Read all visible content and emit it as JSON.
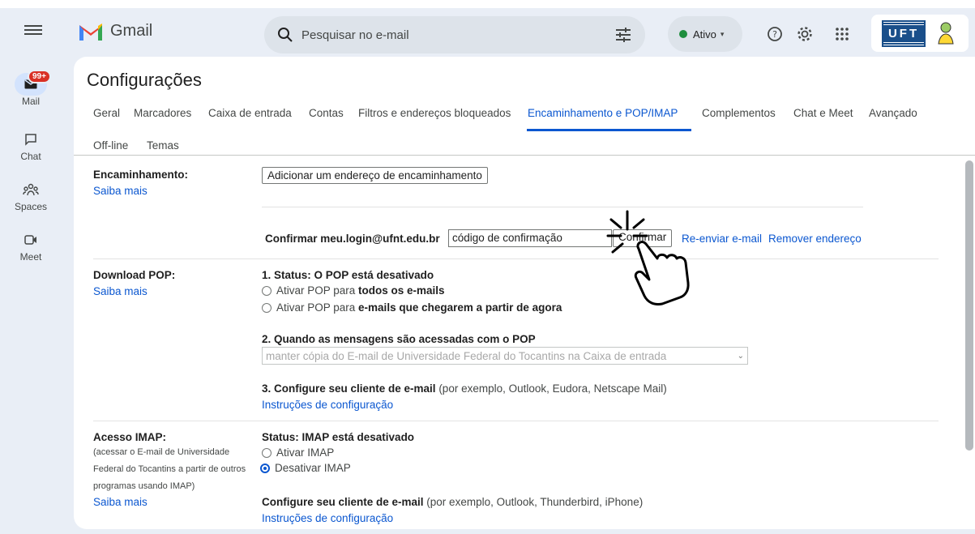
{
  "app": {
    "name": "Gmail"
  },
  "search": {
    "placeholder": "Pesquisar no e-mail"
  },
  "status": {
    "label": "Ativo"
  },
  "org_logo": "UFT",
  "rail": [
    {
      "label": "Mail",
      "badge": "99+"
    },
    {
      "label": "Chat"
    },
    {
      "label": "Spaces"
    },
    {
      "label": "Meet"
    }
  ],
  "page_title": "Configurações",
  "tabs": [
    "Geral",
    "Marcadores",
    "Caixa de entrada",
    "Contas",
    "Filtros e endereços bloqueados",
    "Encaminhamento e POP/IMAP",
    "Complementos",
    "Chat e Meet",
    "Avançado",
    "Off-line",
    "Temas"
  ],
  "forwarding": {
    "label": "Encaminhamento:",
    "learn_more": "Saiba mais",
    "add_button": "Adicionar um endereço de encaminhamento",
    "confirm_label": "Confirmar meu.login@ufnt.edu.br",
    "code_value": "código de confirmação",
    "confirm_button": "Confirmar",
    "resend_link": "Re-enviar e-mail",
    "remove_link": "Remover endereço"
  },
  "pop": {
    "label": "Download POP:",
    "learn_more": "Saiba mais",
    "status_heading": "1. Status: O POP está desativado",
    "option1_prefix": "Ativar POP para ",
    "option1_bold": "todos os e-mails",
    "option2_prefix": "Ativar POP para ",
    "option2_bold": "e-mails que chegarem a partir de agora",
    "when_heading": "2. Quando as mensagens são acessadas com o POP",
    "when_select": "manter cópia do E-mail de Universidade Federal do Tocantins na Caixa de entrada",
    "client_heading": "3. Configure seu cliente de e-mail",
    "client_note": " (por exemplo, Outlook, Eudora, Netscape Mail)",
    "instructions_link": "Instruções de configuração"
  },
  "imap": {
    "label": "Acesso IMAP:",
    "desc": [
      "(acessar o E-mail de Universidade",
      "Federal do Tocantins a partir de outros",
      "programas usando IMAP)"
    ],
    "learn_more": "Saiba mais",
    "status_heading": "Status: IMAP está desativado",
    "option_enable": "Ativar IMAP",
    "option_disable": "Desativar IMAP",
    "client_heading": "Configure seu cliente de e-mail",
    "client_note": " (por exemplo, Outlook, Thunderbird, iPhone)",
    "instructions_link": "Instruções de configuração"
  }
}
